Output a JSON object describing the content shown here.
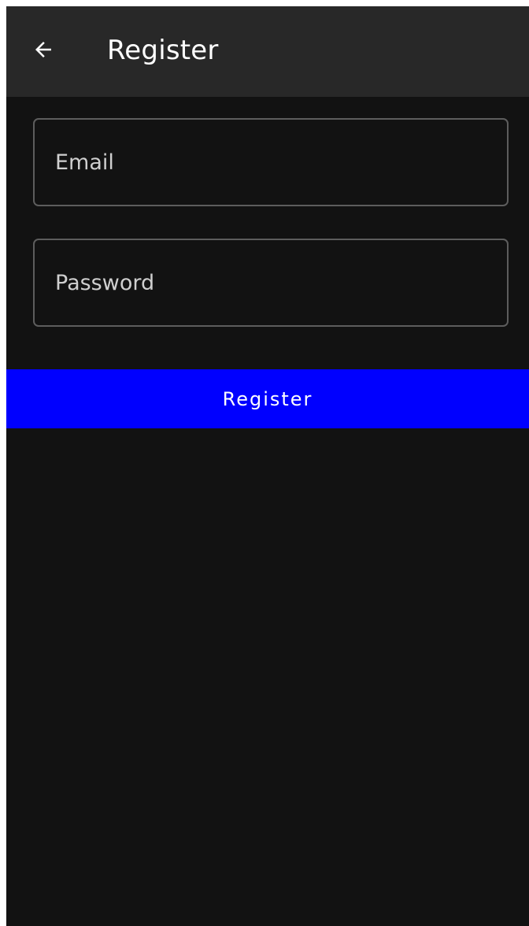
{
  "app_bar": {
    "title": "Register",
    "back_icon": "arrow-left-icon"
  },
  "form": {
    "email": {
      "placeholder": "Email",
      "value": ""
    },
    "password": {
      "placeholder": "Password",
      "value": ""
    },
    "submit_label": "Register"
  },
  "colors": {
    "background": "#121212",
    "app_bar": "#282828",
    "field_border": "#5d5d5d",
    "accent": "#0000ff",
    "text": "#ffffff"
  }
}
